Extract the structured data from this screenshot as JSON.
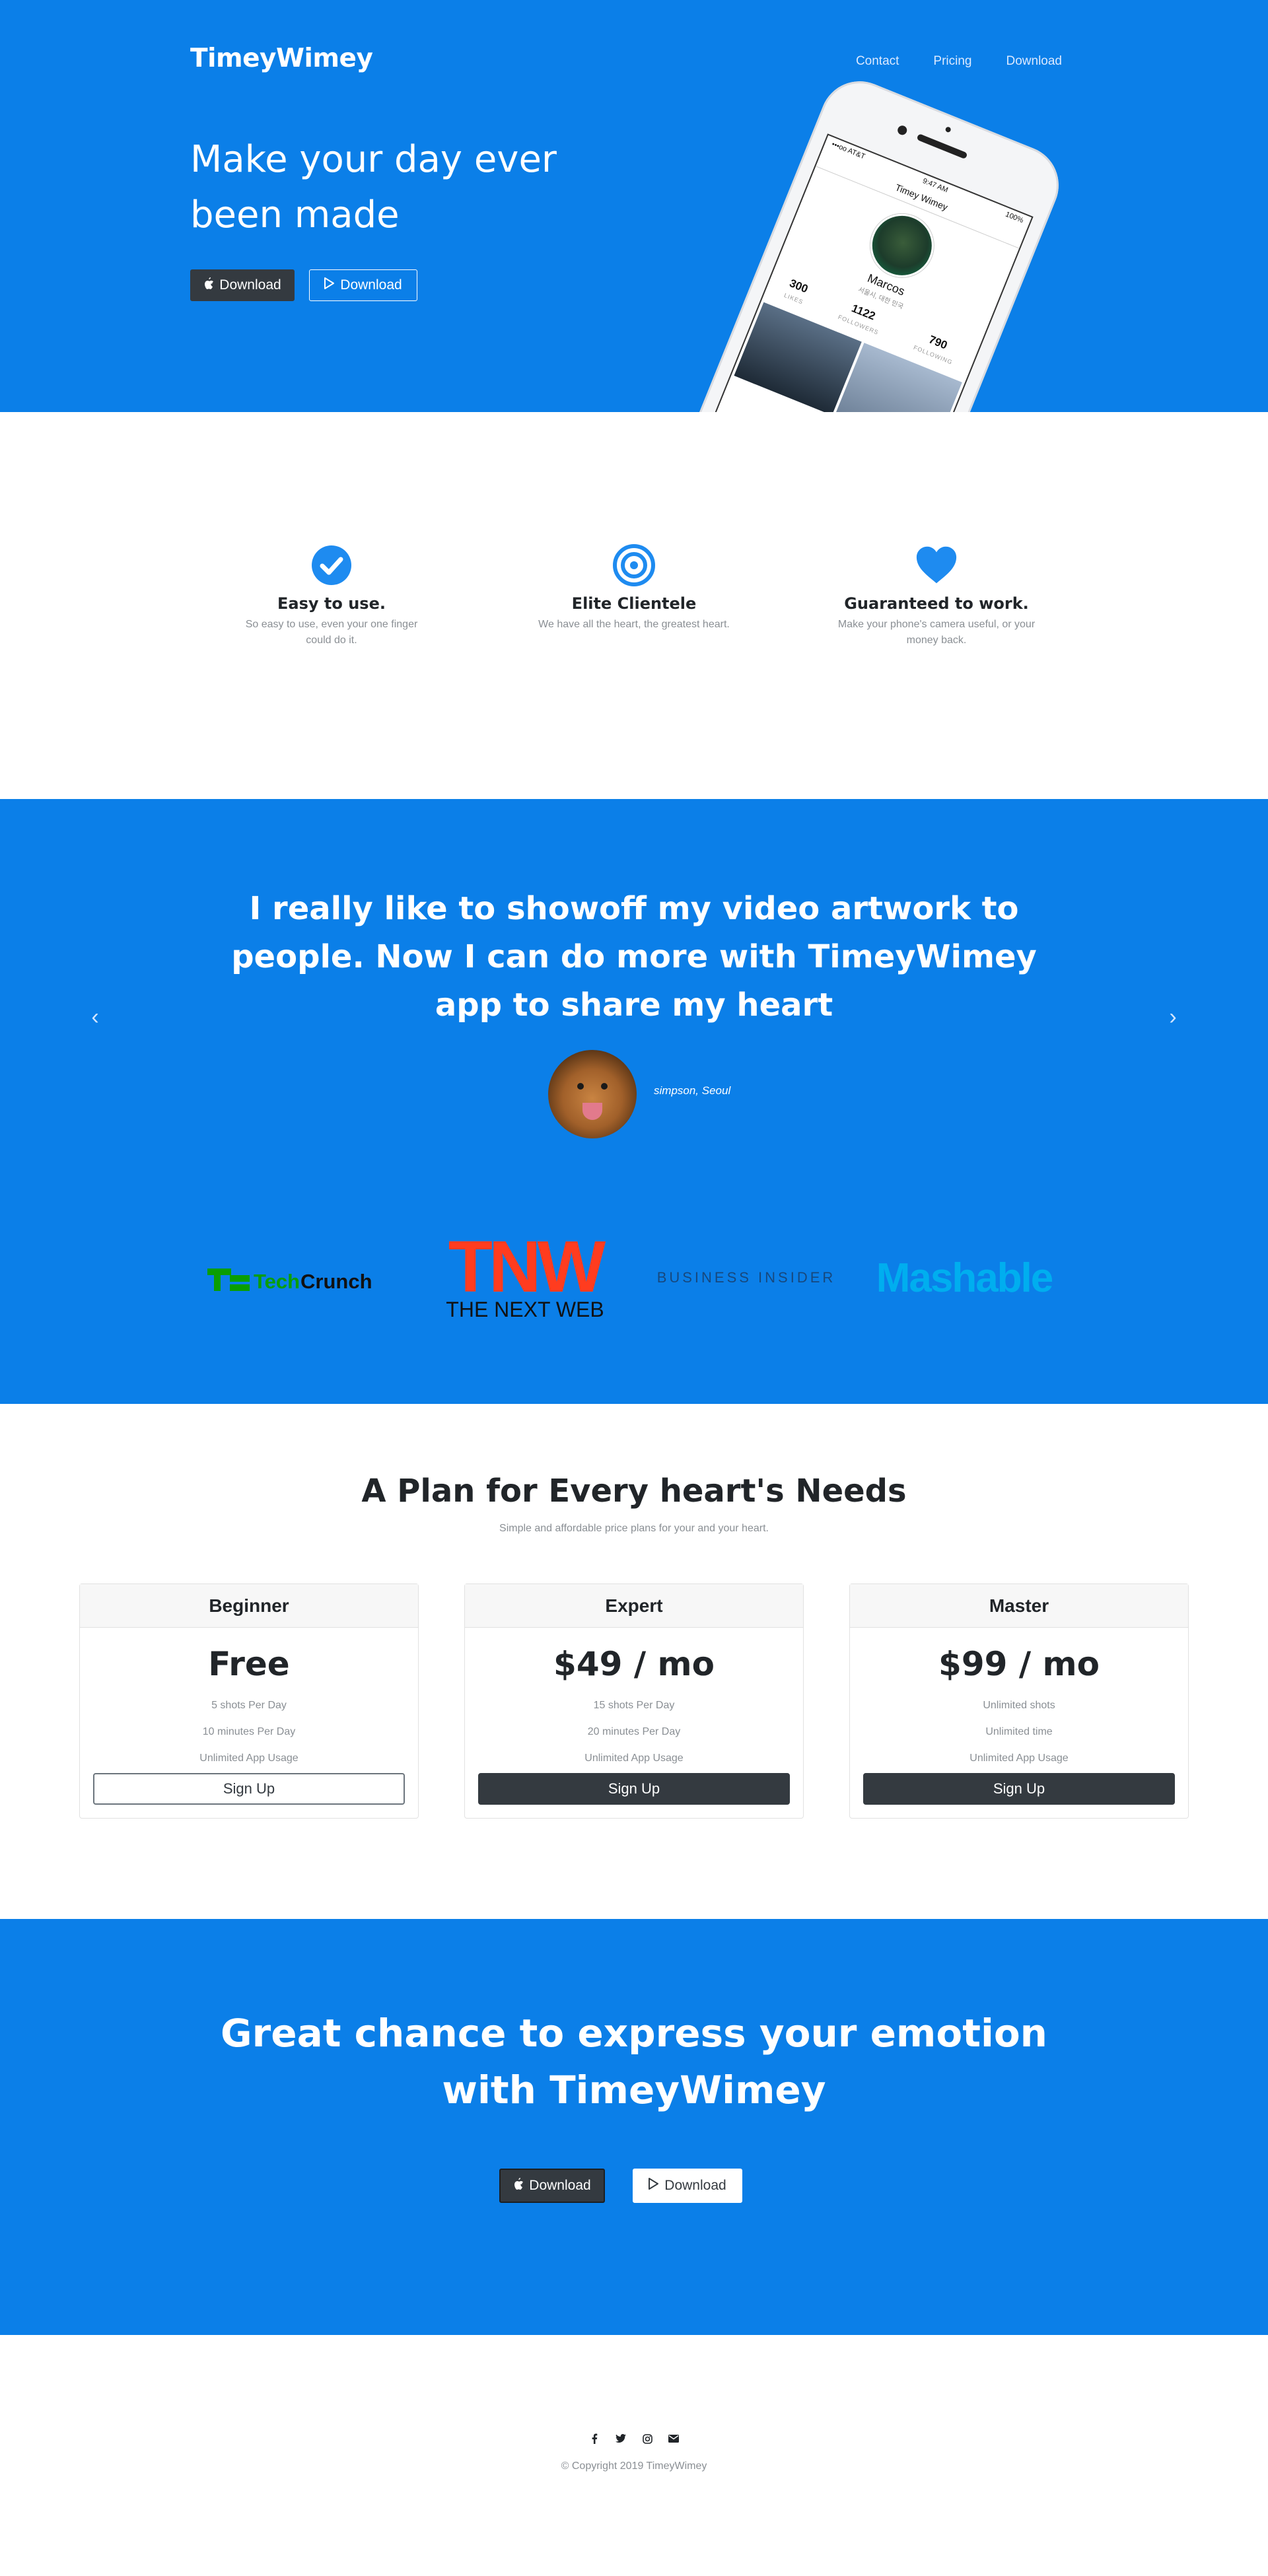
{
  "header": {
    "brand": "TimeyWimey",
    "nav": [
      "Contact",
      "Pricing",
      "Download"
    ]
  },
  "hero": {
    "title": "Make your day ever been made",
    "apple_btn": "Download",
    "play_btn": "Download",
    "phone": {
      "carrier": "•••oo AT&T",
      "time": "9:47 AM",
      "battery": "100%",
      "app_title": "Timey Wimey",
      "user_name": "Marcos",
      "user_sub": "서울시, 대한 민국",
      "stats": [
        {
          "value": "300",
          "label": "LIKES"
        },
        {
          "value": "1122",
          "label": "FOLLOWERS"
        },
        {
          "value": "790",
          "label": "FOLLOWING"
        }
      ]
    }
  },
  "features": [
    {
      "title": "Easy to use.",
      "text": "So easy to use, even your one finger could do it.",
      "icon": "check-circle-icon"
    },
    {
      "title": "Elite Clientele",
      "text": "We have all the heart, the greatest heart.",
      "icon": "target-icon"
    },
    {
      "title": "Guaranteed to work.",
      "text": "Make your phone's camera useful, or your money back.",
      "icon": "heart-icon"
    }
  ],
  "testimonial": {
    "quote": "I really like to showoff my video artwork to people. Now I can do more with TimeyWimey app to share my heart",
    "author": "simpson, Seoul"
  },
  "press": {
    "techcrunch_a": "Tech",
    "techcrunch_b": "Crunch",
    "tnw": "TNW",
    "tnw_sub": "THE NEXT WEB",
    "business_insider": "BUSINESS INSIDER",
    "mashable": "Mashable"
  },
  "pricing": {
    "title": "A Plan for Every heart's Needs",
    "subtitle": "Simple and affordable price plans for your and your heart.",
    "plans": [
      {
        "name": "Beginner",
        "price": "Free",
        "features": [
          "5 shots Per Day",
          "10 minutes Per Day",
          "Unlimited App Usage"
        ],
        "button": "Sign Up"
      },
      {
        "name": "Expert",
        "price": "$49 / mo",
        "features": [
          "15 shots Per Day",
          "20 minutes Per Day",
          "Unlimited App Usage"
        ],
        "button": "Sign Up"
      },
      {
        "name": "Master",
        "price": "$99 / mo",
        "features": [
          "Unlimited shots",
          "Unlimited time",
          "Unlimited App Usage"
        ],
        "button": "Sign Up"
      }
    ]
  },
  "cta": {
    "title": "Great chance to express your emotion with TimeyWimey",
    "apple_btn": "Download",
    "play_btn": "Download"
  },
  "footer": {
    "social": [
      "facebook-icon",
      "twitter-icon",
      "instagram-icon",
      "envelope-icon"
    ],
    "copyright": "© Copyright 2019 TimeyWimey"
  },
  "colors": {
    "primary": "#0b7fe8",
    "dark": "#343a40",
    "muted": "#8a8f94",
    "techcrunch_green": "#0a9e01",
    "tnw_red": "#ff3c1f",
    "mashable_blue": "#00aeef"
  }
}
